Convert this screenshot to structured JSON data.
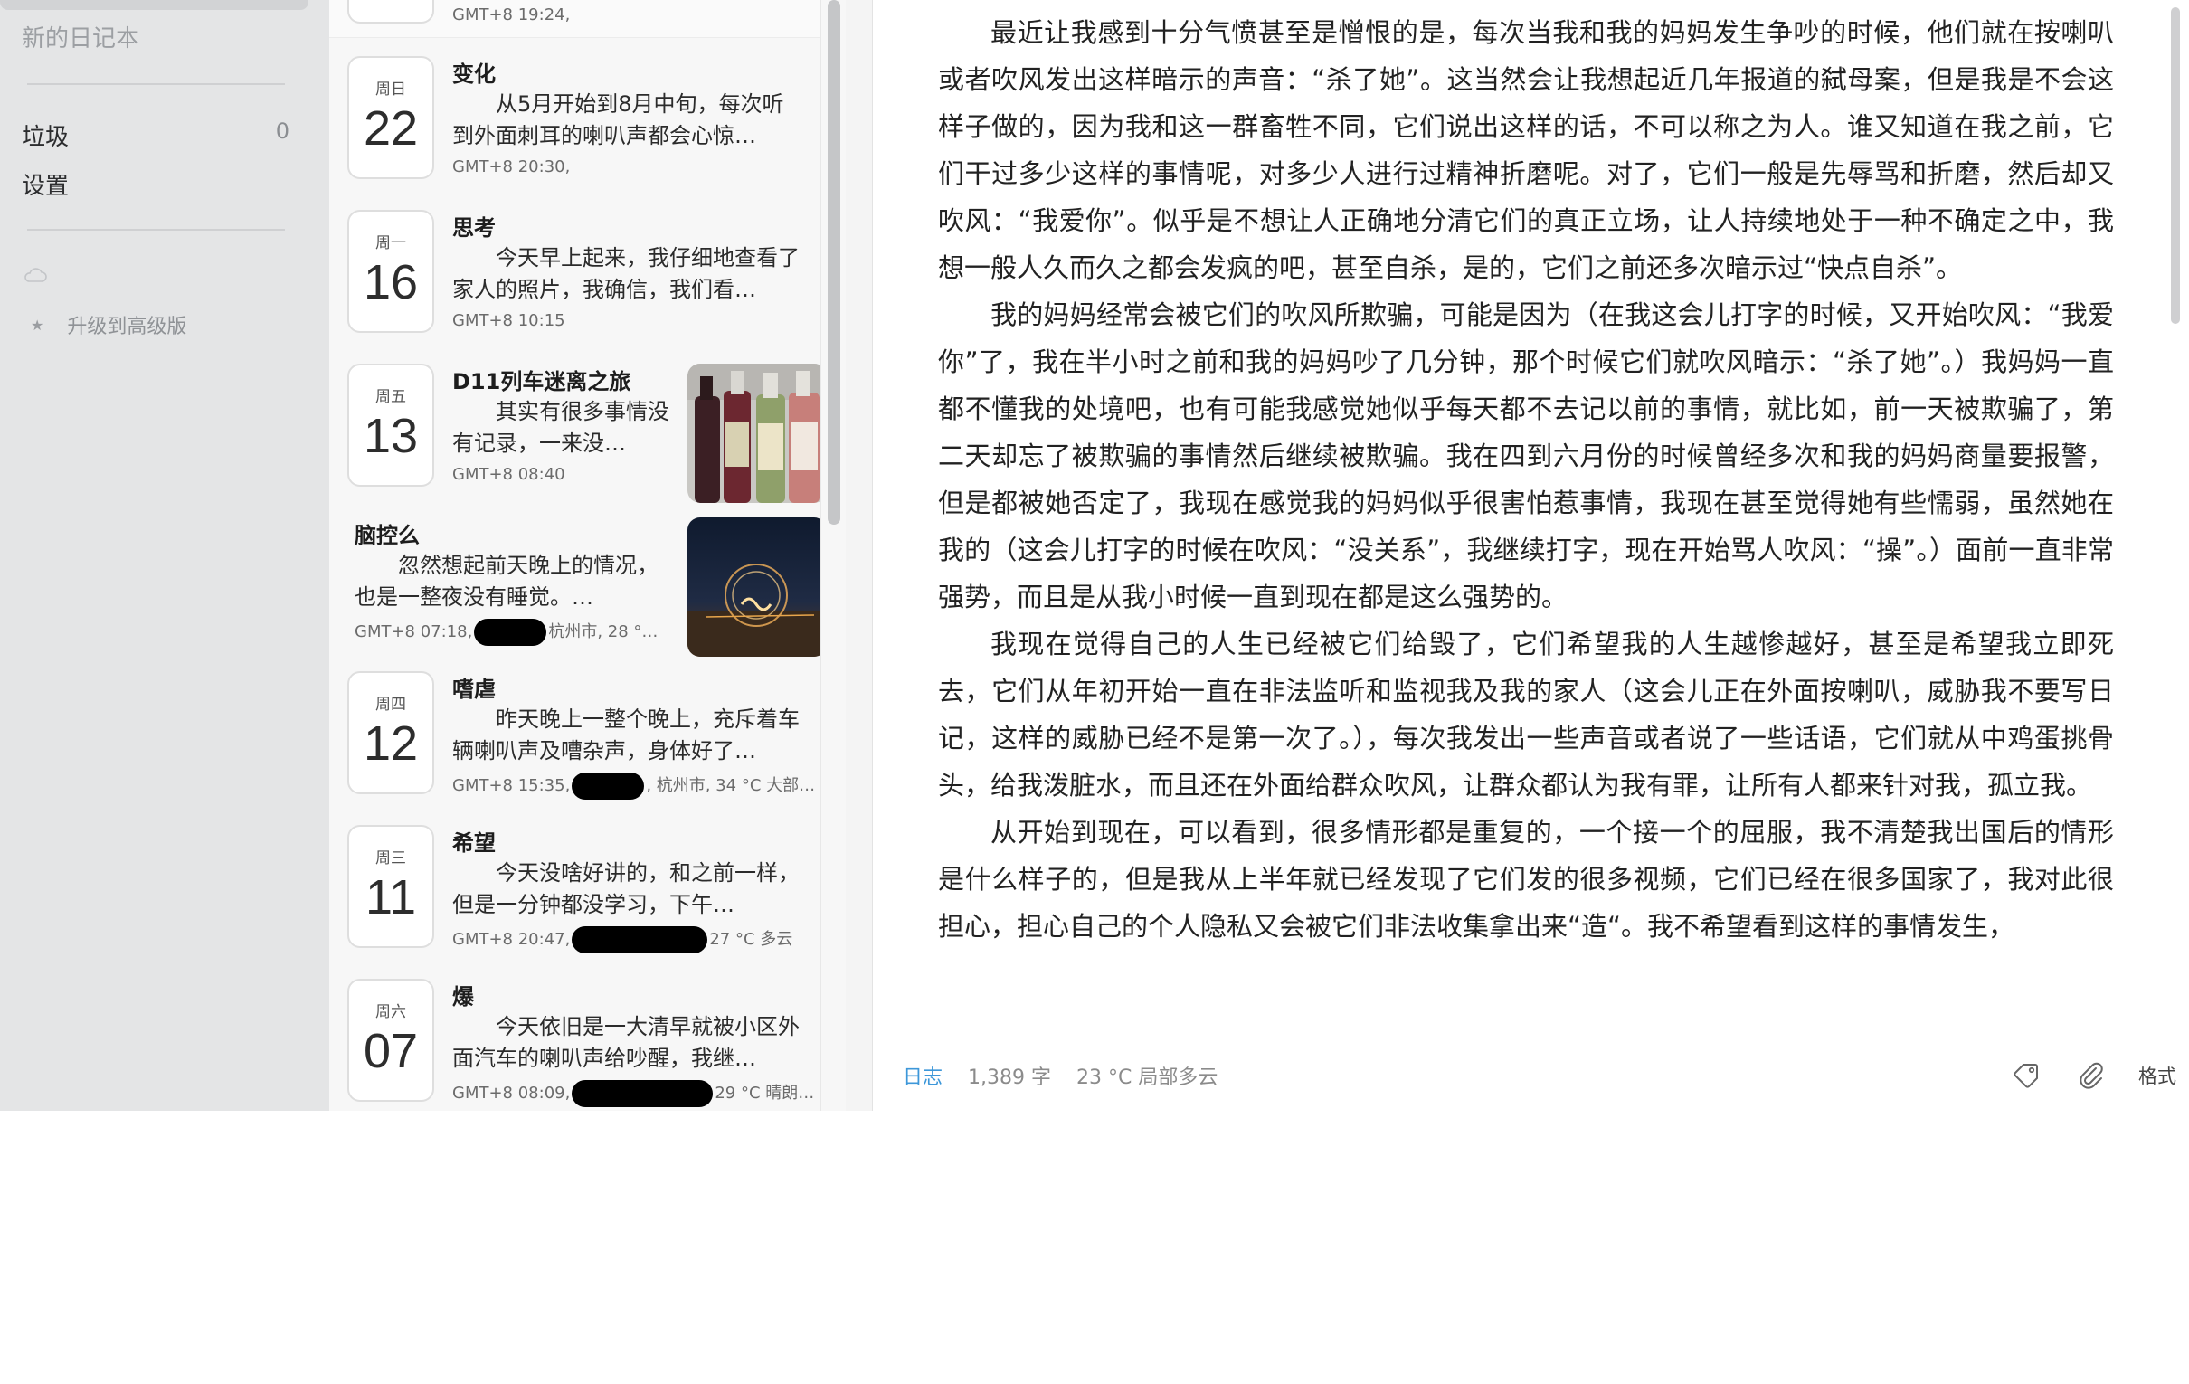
{
  "sidebar": {
    "new_notebook": "新的日记本",
    "trash_label": "垃圾",
    "trash_count": "0",
    "settings_label": "设置",
    "upgrade_label": "升级到高级版"
  },
  "entries": [
    {
      "meta": "GMT+8 19:24,"
    },
    {
      "dow": "周日",
      "day": "22",
      "title": "变化",
      "excerpt": "　　从5月开始到8月中旬，每次听到外面刺耳的喇叭声都会心惊…",
      "meta": "GMT+8 20:30,"
    },
    {
      "dow": "周一",
      "day": "16",
      "title": "思考",
      "excerpt": "　　今天早上起来，我仔细地查看了家人的照片，我确信，我们看…",
      "meta": "GMT+8 10:15"
    },
    {
      "dow": "周五",
      "day": "13",
      "title": "D11列车迷离之旅",
      "excerpt": "　　其实有很多事情没有记录，一来没…",
      "meta": "GMT+8 08:40",
      "image": "bottles-photo"
    },
    {
      "title": "脑控么",
      "excerpt": "　　忽然想起前天晚上的情况，也是一整夜没有睡觉。…",
      "meta_before": "GMT+8 07:18,",
      "meta_after": "杭州市, 28 °…",
      "image": "light-painting-photo"
    },
    {
      "dow": "周四",
      "day": "12",
      "title": "嗜虐",
      "excerpt": "　　昨天晚上一整个晚上，充斥着车辆喇叭声及嘈杂声，身体好了…",
      "meta_before": "GMT+8 15:35,",
      "meta_after": ", 杭州市, 34 °C 大部…"
    },
    {
      "dow": "周三",
      "day": "11",
      "title": "希望",
      "excerpt": "　　今天没啥好讲的，和之前一样，但是一分钟都没学习，下午…",
      "meta_before": "GMT+8 20:47,",
      "meta_after": "27 °C 多云"
    },
    {
      "dow": "周六",
      "day": "07",
      "title": "爆",
      "excerpt": "　　今天依旧是一大清早就被小区外面汽车的喇叭声给吵醒，我继…",
      "meta_before": "GMT+8 08:09,",
      "meta_after": "29 °C 晴朗…"
    }
  ],
  "editor": {
    "paragraphs": [
      "最近让我感到十分气愤甚至是憎恨的是，每次当我和我的妈妈发生争吵的时候，他们就在按喇叭或者吹风发出这样暗示的声音：“杀了她”。这当然会让我想起近几年报道的弑母案，但是我是不会这样子做的，因为我和这一群畜牲不同，它们说出这样的话，不可以称之为人。谁又知道在我之前，它们干过多少这样的事情呢，对多少人进行过精神折磨呢。对了，它们一般是先辱骂和折磨，然后却又吹风：“我爱你”。似乎是不想让人正确地分清它们的真正立场，让人持续地处于一种不确定之中，我想一般人久而久之都会发疯的吧，甚至自杀，是的，它们之前还多次暗示过“快点自杀”。",
      "我的妈妈经常会被它们的吹风所欺骗，可能是因为（在我这会儿打字的时候，又开始吹风：“我爱你”了，我在半小时之前和我的妈妈吵了几分钟，那个时候它们就吹风暗示：“杀了她”。）我妈妈一直都不懂我的处境吧，也有可能我感觉她似乎每天都不去记以前的事情，就比如，前一天被欺骗了，第二天却忘了被欺骗的事情然后继续被欺骗。我在四到六月份的时候曾经多次和我的妈妈商量要报警，但是都被她否定了，我现在感觉我的妈妈似乎很害怕惹事情，我现在甚至觉得她有些懦弱，虽然她在我的（这会儿打字的时候在吹风：“没关系”，我继续打字，现在开始骂人吹风：“操”。）面前一直非常强势，而且是从我小时候一直到现在都是这么强势的。",
      "我现在觉得自己的人生已经被它们给毁了，它们希望我的人生越惨越好，甚至是希望我立即死去，它们从年初开始一直在非法监听和监视我及我的家人（这会儿正在外面按喇叭，威胁我不要写日记，这样的威胁已经不是第一次了。），每次我发出一些声音或者说了一些话语，它们就从中鸡蛋挑骨头，给我泼脏水，而且还在外面给群众吹风，让群众都认为我有罪，让所有人都来针对我，孤立我。",
      "从开始到现在，可以看到，很多情形都是重复的，一个接一个的屈服，我不清楚我出国后的情形是什么样子的，但是我从上半年就已经发现了它们发的很多视频，它们已经在很多国家了，我对此很担心，担心自己的个人隐私又会被它们非法收集拿出来“造“。我不希望看到这样的事情发生，"
    ]
  },
  "statusbar": {
    "notebook": "日志",
    "word_count": "1,389 字",
    "weather": "23 °C 局部多云",
    "format_label": "格式"
  }
}
